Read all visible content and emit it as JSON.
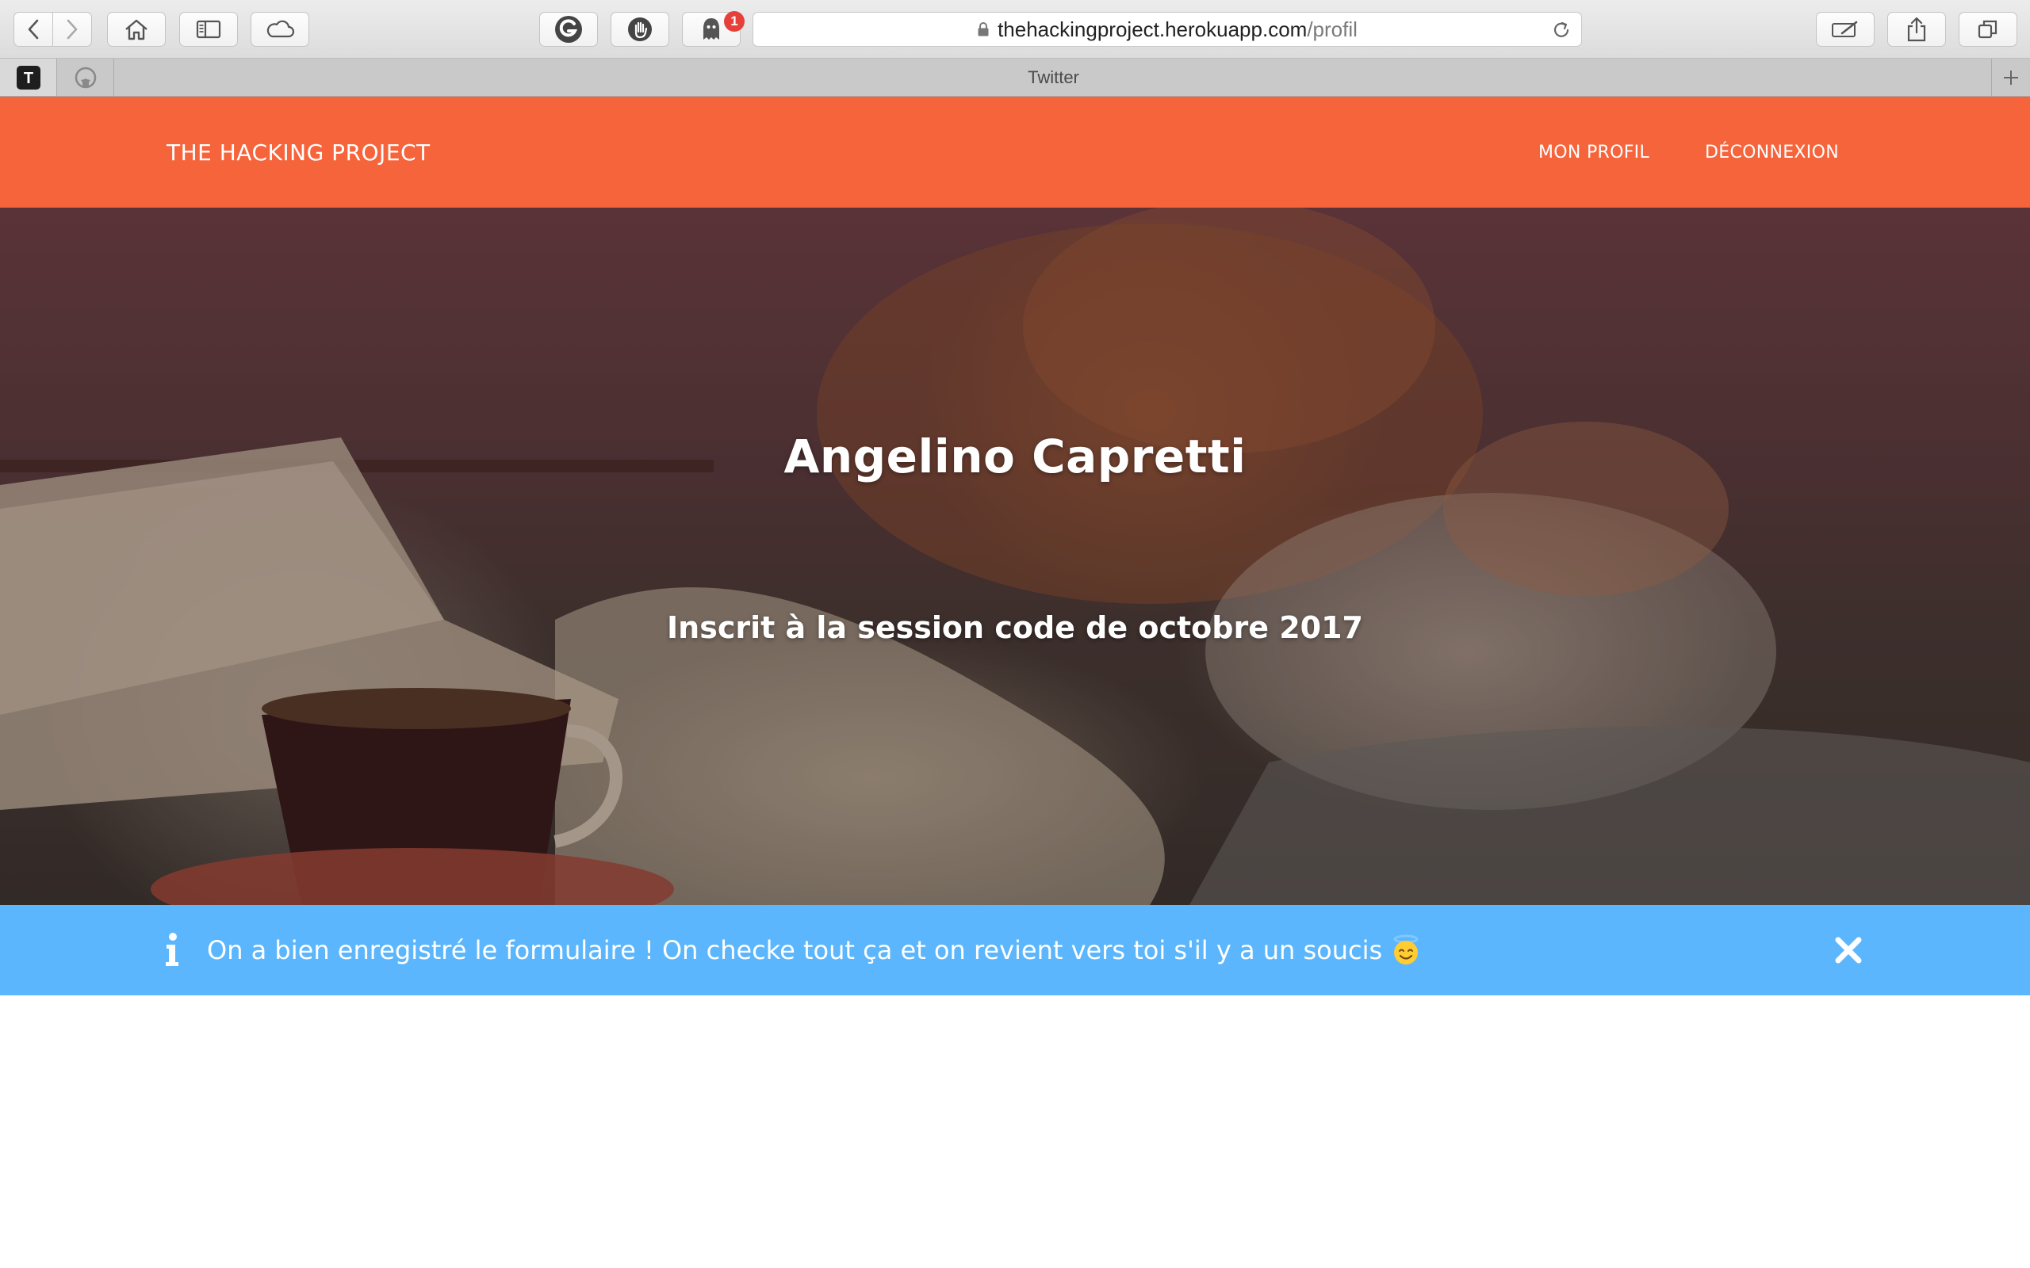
{
  "browser": {
    "url_domain": "thehackingproject.herokuapp.com",
    "url_path": "/profil",
    "tab_title": "Twitter",
    "pinned_tabs": [
      "T",
      "github"
    ],
    "extension_badge_count": "1",
    "icons": [
      "back-icon",
      "forward-icon",
      "home-icon",
      "sidebar-icon",
      "cloud-icon",
      "grammarly-icon",
      "hand-icon",
      "ghostery-icon",
      "lock-icon",
      "reload-icon",
      "annotate-icon",
      "share-icon",
      "tabs-overview-icon",
      "new-tab-icon"
    ]
  },
  "navbar": {
    "brand": "THE HACKING PROJECT",
    "links": [
      {
        "label": "MON PROFIL"
      },
      {
        "label": "DÉCONNEXION"
      }
    ],
    "color": "#f6643b"
  },
  "hero": {
    "name": "Angelino Capretti",
    "subtitle": "Inscrit à la session code de octobre 2017"
  },
  "alert": {
    "message": "On a bien enregistré le formulaire ! On checke tout ça et on revient vers toi s'il y a un soucis",
    "emoji": "smiling-face-with-halo",
    "color": "#5bb6fd"
  }
}
